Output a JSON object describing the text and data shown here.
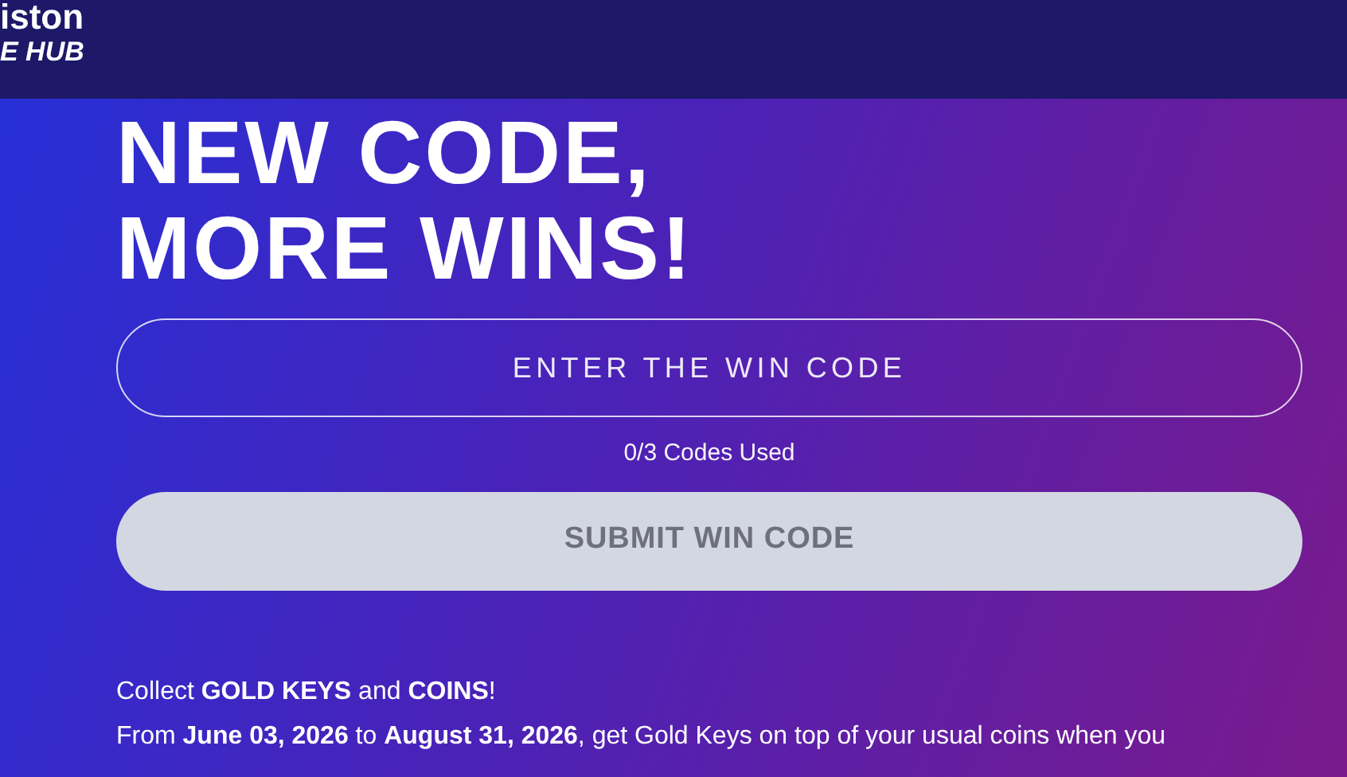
{
  "header": {
    "logo_lines": [
      "iston",
      "E HUB"
    ]
  },
  "heading": [
    "NEW CODE,",
    "MORE WINS!"
  ],
  "code_field": {
    "placeholder": "ENTER THE WIN CODE"
  },
  "usage": "0/3 Codes Used",
  "submit_button": {
    "label": "SUBMIT WIN CODE",
    "disabled": true
  },
  "info": [
    "Collect **GOLD KEYS** and **COINS**!",
    "From **June 03, 2026** to **August 31, 2026**, get Gold Keys on top of your usual coins when you"
  ]
}
